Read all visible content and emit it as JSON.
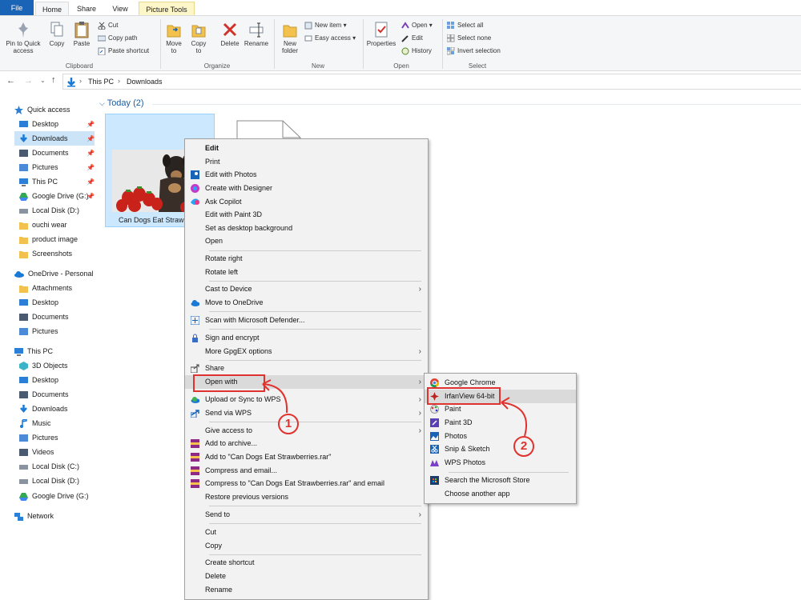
{
  "tabs": {
    "file": "File",
    "home": "Home",
    "share": "Share",
    "view": "View",
    "picture_tools": "Picture Tools"
  },
  "ribbon": {
    "pin_quick_access": "Pin to Quick access",
    "copy": "Copy",
    "paste": "Paste",
    "cut": "Cut",
    "copy_path": "Copy path",
    "paste_shortcut": "Paste shortcut",
    "clipboard_group": "Clipboard",
    "move_to": "Move to",
    "copy_to": "Copy to",
    "delete": "Delete",
    "rename": "Rename",
    "organize_group": "Organize",
    "new_folder": "New folder",
    "new_item": "New item",
    "easy_access": "Easy access",
    "new_group": "New",
    "properties": "Properties",
    "open": "Open",
    "edit": "Edit",
    "history": "History",
    "open_group": "Open",
    "select_all": "Select all",
    "select_none": "Select none",
    "invert_selection": "Invert selection",
    "select_group": "Select"
  },
  "address": {
    "this_pc": "This PC",
    "downloads": "Downloads",
    "sep": "›"
  },
  "nav": {
    "quick_access": "Quick access",
    "qa_items": [
      "Desktop",
      "Downloads",
      "Documents",
      "Pictures",
      "This PC",
      "Google Drive (G:)",
      "Local Disk (D:)",
      "ouchi wear",
      "product image",
      "Screenshots"
    ],
    "onedrive": "OneDrive - Personal",
    "od_items": [
      "Attachments",
      "Desktop",
      "Documents",
      "Pictures"
    ],
    "this_pc": "This PC",
    "pc_items": [
      "3D Objects",
      "Desktop",
      "Documents",
      "Downloads",
      "Music",
      "Pictures",
      "Videos",
      "Local Disk (C:)",
      "Local Disk (D:)",
      "Google Drive (G:)"
    ],
    "network": "Network"
  },
  "content": {
    "group_header": "Today (2)",
    "file_name": "Can Dogs Eat Strawb"
  },
  "context_menu": {
    "edit": "Edit",
    "print": "Print",
    "edit_photos": "Edit with Photos",
    "create_designer": "Create with Designer",
    "ask_copilot": "Ask Copilot",
    "edit_paint3d": "Edit with Paint 3D",
    "set_desktop": "Set as desktop background",
    "open": "Open",
    "rotate_right": "Rotate right",
    "rotate_left": "Rotate left",
    "cast": "Cast to Device",
    "move_onedrive": "Move to OneDrive",
    "scan_defender": "Scan with Microsoft Defender...",
    "sign_encrypt": "Sign and encrypt",
    "more_gpgex": "More GpgEX options",
    "share": "Share",
    "open_with": "Open with",
    "upload_wps": "Upload or Sync to WPS",
    "send_wps": "Send via WPS",
    "give_access": "Give access to",
    "add_archive": "Add to archive...",
    "add_rar": "Add to \"Can Dogs Eat Strawberries.rar\"",
    "compress_email": "Compress and email...",
    "compress_rar_email": "Compress to \"Can Dogs Eat Strawberries.rar\" and email",
    "restore": "Restore previous versions",
    "send_to": "Send to",
    "cut": "Cut",
    "copy": "Copy",
    "create_shortcut": "Create shortcut",
    "delete": "Delete",
    "rename": "Rename"
  },
  "open_with_menu": {
    "chrome": "Google Chrome",
    "irfanview": "IrfanView 64-bit",
    "paint": "Paint",
    "paint3d": "Paint 3D",
    "photos": "Photos",
    "snip": "Snip & Sketch",
    "wps_photos": "WPS Photos",
    "ms_store": "Search the Microsoft Store",
    "choose_app": "Choose another app"
  },
  "annotations": {
    "step1": "1",
    "step2": "2"
  },
  "colors": {
    "accent": "#1a64b8",
    "annotation_red": "#e0322e",
    "selection": "#cce4f7"
  }
}
